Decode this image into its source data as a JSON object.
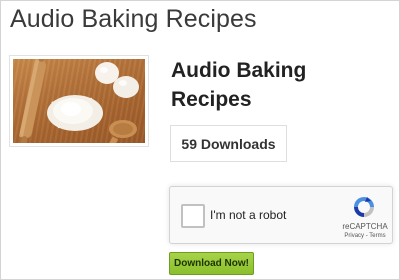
{
  "page": {
    "title": "Audio Baking Recipes"
  },
  "product": {
    "title_line1": "Audio Baking",
    "title_line2": "Recipes",
    "image_icon": "baking-photo-icon",
    "downloads_label": "59 Downloads"
  },
  "recaptcha": {
    "checkbox_label": "I'm not a robot",
    "brand": "reCAPTCHA",
    "terms": "Privacy - Terms",
    "logo_icon": "recaptcha-logo-icon",
    "colors": {
      "blue": "#1c3aa9",
      "light_blue": "#4a90e2",
      "gray": "#c1c1c1"
    }
  },
  "actions": {
    "download_label": "Download Now!",
    "download_color": "#8bbf2c"
  }
}
